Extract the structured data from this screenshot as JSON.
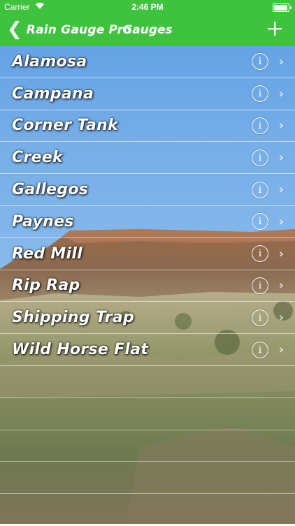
{
  "status_bar": {
    "carrier": "Carrier",
    "time": "2:46 PM",
    "battery_level": 0.95
  },
  "nav": {
    "back_label": "Rain Gauge Pro",
    "title": "Gauges"
  },
  "gauges": [
    {
      "name": "Alamosa"
    },
    {
      "name": "Campana"
    },
    {
      "name": "Corner Tank"
    },
    {
      "name": "Creek"
    },
    {
      "name": "Gallegos"
    },
    {
      "name": "Paynes"
    },
    {
      "name": "Red Mill"
    },
    {
      "name": "Rip Rap"
    },
    {
      "name": "Shipping Trap"
    },
    {
      "name": "Wild Horse Flat"
    }
  ],
  "icons": {
    "back": "chevron-left-icon",
    "add": "plus-icon",
    "info": "info-circle-icon",
    "disclosure": "chevron-right-icon"
  },
  "colors": {
    "nav_green": "#3fc33f",
    "sky_top": "#6aa7e6",
    "sky_bottom": "#c8dff2",
    "text": "#ffffff"
  }
}
